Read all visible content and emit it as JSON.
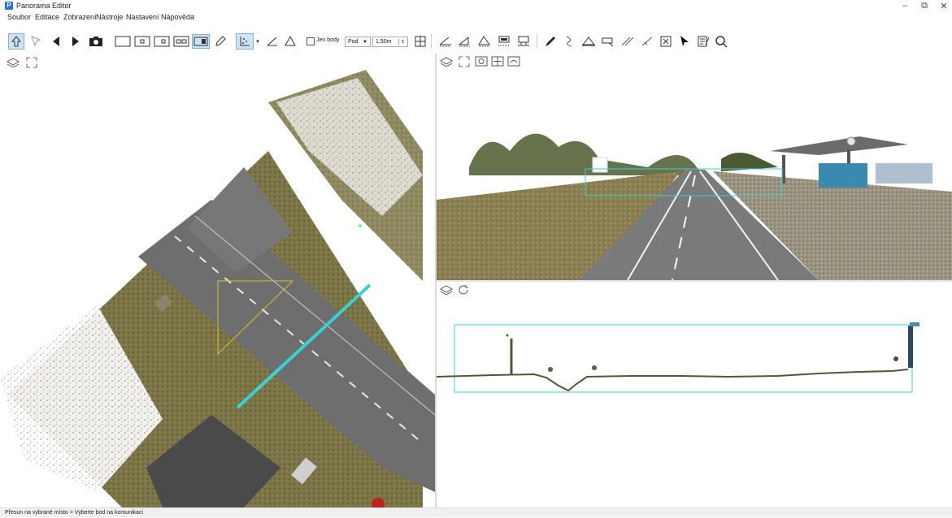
{
  "window": {
    "title": "Panorama Editor",
    "app_icon": "panorama-app-icon",
    "controls": [
      "–",
      "⧉",
      "✕"
    ]
  },
  "menu": {
    "items": [
      "Soubor",
      "Editace",
      "Zobrazení",
      "Nástroje",
      "Nastavení",
      "Nápověda"
    ]
  },
  "toolbar": {
    "only_points_label": "Jen body",
    "mode_value": "Pod",
    "distance_value": "1,50m",
    "icons": [
      "up-arrow-icon",
      "select-arrow-icon",
      "prev-icon",
      "next-icon",
      "camera-icon",
      "rect-view-icon",
      "single-view-icon",
      "dual-view-icon",
      "quad-view-icon",
      "panel-view-icon",
      "pencil-icon",
      "point-cloud-icon",
      "angle-icon",
      "triangle-icon",
      "grid-icon",
      "measure-line-icon",
      "measure-height-icon",
      "measure-slope-icon",
      "layers-icon",
      "frame-icon",
      "draw-icon",
      "curve-icon",
      "polygon-icon",
      "shape-icon",
      "cut-icon",
      "split-icon",
      "delete-box-icon",
      "cursor-icon",
      "edit-list-icon",
      "magnifier-icon"
    ]
  },
  "status": {
    "text": "Přesun na vybrané místo > Vyberte bod na komunikaci"
  },
  "colors": {
    "accent_line": "#35d3d1",
    "yellow_triangle": "#d8c030",
    "asphalt": "#6e6e6e",
    "grass": "#7a7345"
  }
}
